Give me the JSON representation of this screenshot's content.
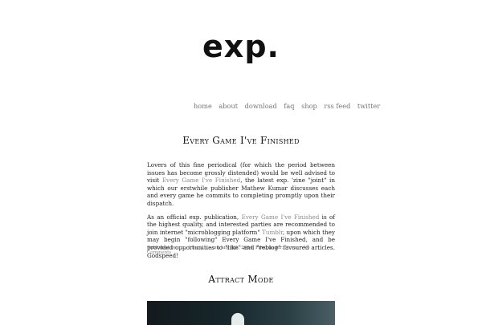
{
  "site": {
    "logo": "exp."
  },
  "nav": {
    "items": [
      {
        "label": "home"
      },
      {
        "label": "about"
      },
      {
        "label": "download"
      },
      {
        "label": "faq"
      },
      {
        "label": "shop"
      },
      {
        "label": "rss feed"
      },
      {
        "label": "twitter"
      }
    ]
  },
  "post1": {
    "title": "Every Game I've Finished",
    "p1": {
      "text_a": "Lovers of this fine periodical (for which the period between issues has become grossly distended) would be well advised to visit ",
      "link": "Every Game I've Finished",
      "text_b": ", the latest exp. 'zine \"joint\" in which our erstwhile publisher Mathew Kumar discusses each and every game he commits to completing promptly upon their dispatch."
    },
    "p2": {
      "text_a": "As an official exp. publication, ",
      "link1": "Every Game I've Finished",
      "text_b": " is of the highest quality, and interested parties are recommended to join internet \"microblogging platform\" ",
      "link2": "Tumblr",
      "text_c": ", upon which they may begin \"following\" Every Game I've Finished, and be provided opportunities to \"like\" and \"reblog\" favoured articles. Godspeed!"
    },
    "meta": {
      "prefix": "Published by ",
      "author": "exp. Magazine",
      "date_text": ", on July 8th, 2014. Filed under: ",
      "category": "News",
      "sep": " • ",
      "comments": "No Comments"
    }
  },
  "post2": {
    "title": "Attract Mode"
  }
}
